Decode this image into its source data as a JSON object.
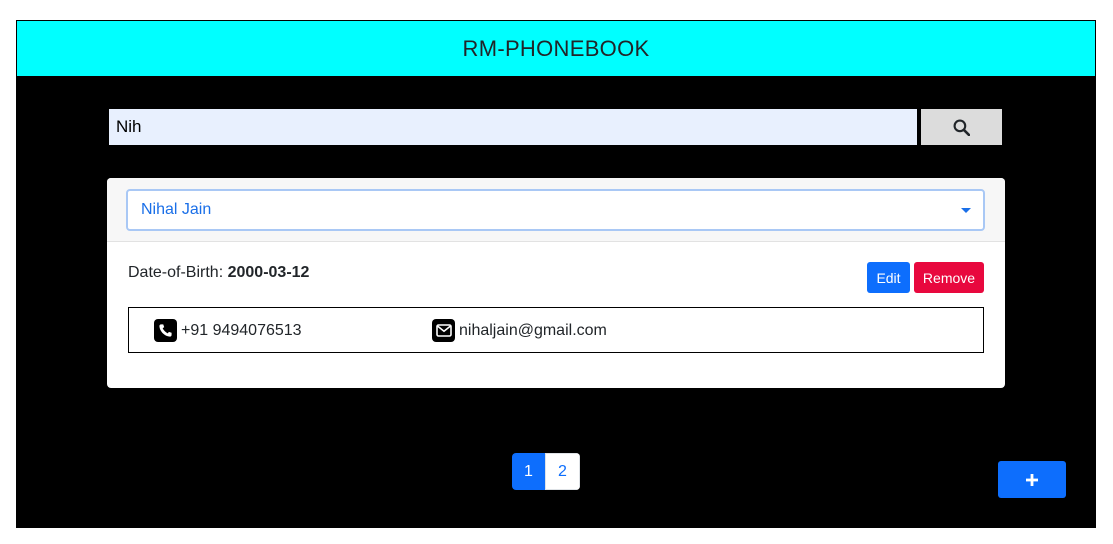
{
  "header": {
    "title": "RM-PHONEBOOK"
  },
  "search": {
    "value": "Nih",
    "icon": "search-icon"
  },
  "contact": {
    "selected_name": "Nihal Jain",
    "dob_label": "Date-of-Birth:",
    "dob_value": "2000-03-12",
    "edit_label": "Edit",
    "remove_label": "Remove",
    "phone": "+91 9494076513",
    "email": "nihaljain@gmail.com"
  },
  "pagination": {
    "pages": [
      "1",
      "2"
    ],
    "active": "1"
  },
  "add_button": {
    "label": "+",
    "icon": "plus-icon"
  },
  "colors": {
    "header_bg": "#00ffff",
    "page_bg": "#000000",
    "primary": "#0d6efd",
    "danger": "#e8083e",
    "search_bg": "#e8f0fe"
  }
}
